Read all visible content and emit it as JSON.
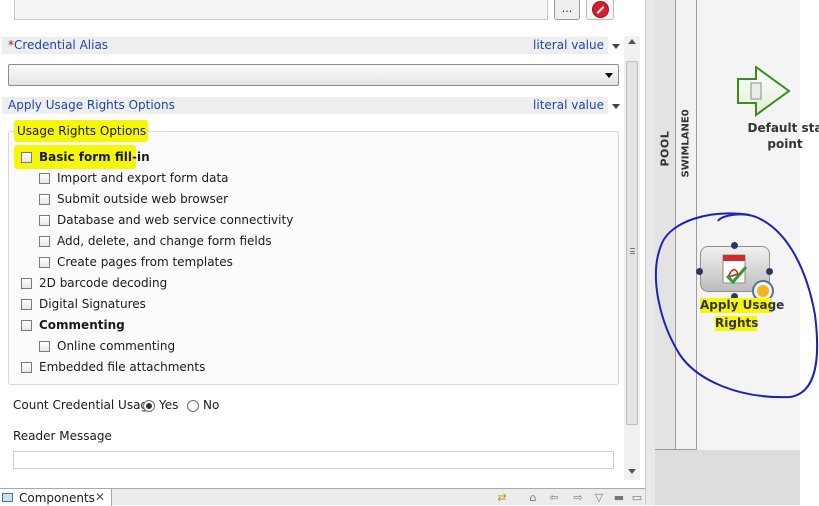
{
  "top": {
    "browse_label": "..."
  },
  "credential_alias": {
    "required_marker": "*",
    "label": "Credential Alias",
    "mode": "literal value",
    "value": ""
  },
  "usage_rights": {
    "label": "Apply Usage Rights Options",
    "mode": "literal value",
    "group_title": "Usage Rights Options",
    "options": [
      {
        "label": "Basic form fill-in",
        "checked": false,
        "bold": true
      },
      {
        "label": "Import and export form data",
        "checked": false
      },
      {
        "label": "Submit outside web browser",
        "checked": false
      },
      {
        "label": "Database and web service connectivity",
        "checked": false
      },
      {
        "label": "Add, delete, and change form fields",
        "checked": false
      },
      {
        "label": "Create pages from templates",
        "checked": false
      },
      {
        "label": "2D barcode decoding",
        "checked": false
      },
      {
        "label": "Digital Signatures",
        "checked": false
      },
      {
        "label": "Commenting",
        "checked": false,
        "bold": true
      },
      {
        "label": "Online commenting",
        "checked": false
      },
      {
        "label": "Embedded file attachments",
        "checked": false
      }
    ]
  },
  "count_credential_usage": {
    "label": "Count Credential Usage",
    "options": [
      "Yes",
      "No"
    ],
    "selected": "Yes"
  },
  "reader_message": {
    "label": "Reader Message",
    "value": ""
  },
  "bottom_tab": {
    "label": "Components",
    "close": "✕"
  },
  "canvas": {
    "pool_label": "POOL",
    "lane_label": "SWIMLANE0",
    "start_event": {
      "line1": "Default sta",
      "line2": "point"
    },
    "activity": {
      "line1": "Apply Usage",
      "line2": "Rights"
    }
  },
  "colors": {
    "highlight": "#f6f60a",
    "link_blue": "#2047a5",
    "annotation": "#1b22b8",
    "required": "#d00000"
  }
}
